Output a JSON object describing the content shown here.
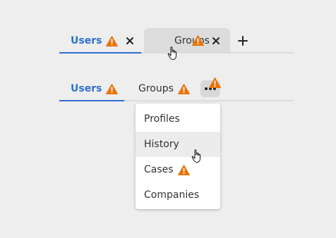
{
  "colors": {
    "accent": "#2e6fd1",
    "warning": "#e8740c",
    "background": "#eeeeee",
    "tab_hover_bg": "#dcdcdc",
    "menu_hover_bg": "#ececec"
  },
  "tabbar_1": {
    "tabs": [
      {
        "label": "Users",
        "active": true,
        "warning": true,
        "closable": true
      },
      {
        "label": "Groups",
        "active": false,
        "hovered": true,
        "warning": true,
        "closable": true
      }
    ],
    "add_icon": "plus-icon"
  },
  "tabbar_2": {
    "tabs": [
      {
        "label": "Users",
        "active": true,
        "warning": true
      },
      {
        "label": "Groups",
        "active": false,
        "warning": true
      }
    ],
    "overflow_icon": "more-horizontal-icon",
    "overflow_warning": true
  },
  "overflow_menu": {
    "items": [
      {
        "label": "Profiles",
        "warning": false,
        "hovered": false
      },
      {
        "label": "History",
        "warning": false,
        "hovered": true
      },
      {
        "label": "Cases",
        "warning": true,
        "hovered": false
      },
      {
        "label": "Companies",
        "warning": false,
        "hovered": false
      }
    ]
  },
  "icons": {
    "warning": "warning-triangle-icon",
    "close": "close-icon",
    "cursor": "hand-pointer-cursor"
  }
}
